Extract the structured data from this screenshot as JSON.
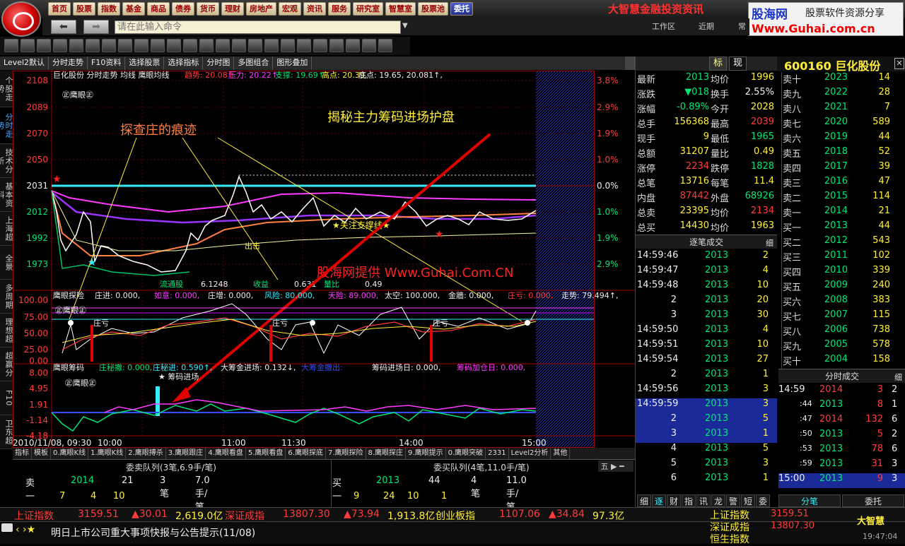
{
  "menu": [
    "首页",
    "股票",
    "指数",
    "基金",
    "商品",
    "债券",
    "货币",
    "理财",
    "房地产",
    "宏观",
    "资讯",
    "服务",
    "研究室",
    "智慧室",
    "股票池",
    "委托"
  ],
  "menu_active": 15,
  "brand": "大智慧金融投资资讯",
  "watermark_top": {
    "site": "股海网",
    "tag": "股票软件资源分享",
    "url": "Www.Guhai.com.cn"
  },
  "command_placeholder": "请在此输入命令",
  "right_links": [
    "工作区",
    "近期",
    "常"
  ],
  "tabbar": [
    "Level2默认",
    "分时走势",
    "F10资料",
    "选择股票",
    "选择指标",
    "分时图",
    "多图组合",
    "图形叠加"
  ],
  "vtabs": [
    "个股走势",
    "分时走势",
    "技术分析",
    "基本资料",
    "上海超",
    "全景",
    "多周期",
    "理想超",
    "超赢分",
    "F10",
    "卫东超"
  ],
  "vtab_selected": 1,
  "chart": {
    "title": "巨化股份 分时走势  均线  鹰眼均线",
    "price_line_labels": [
      {
        "text": "趋势: 20.08↑",
        "color": "#ff3b3b"
      },
      {
        "text": "压力: 20.22↑",
        "color": "#ff3bff"
      },
      {
        "text": "支撑: 19.69↑",
        "color": "#00e676"
      },
      {
        "text": "高点: 20.39,",
        "color": "#ffef3a"
      },
      {
        "text": "底点: 19.65,  20.081↑,",
        "color": "#eee"
      }
    ],
    "y_labels_left": [
      "2108",
      "2089",
      "2070",
      "2050",
      "2031",
      "2012",
      "1992",
      "1973"
    ],
    "y_labels_right": [
      "3.8%",
      "2.9%",
      "1.9%",
      "1.0%",
      "0.0%",
      "1.0%",
      "1.9%",
      "2.9%"
    ],
    "eye_tag": "㊣鹰眼㊣",
    "annotation_1": "探查庄的痕迹",
    "annotation_2": "揭秘主力筹码进场护盘",
    "support_text": "★关注支撑线★",
    "exit_text": "出击",
    "watermark": "股海网提供 Www.Guhai.Com.CN",
    "bottom_stats": [
      {
        "k": "流通股",
        "v": "6.1248"
      },
      {
        "k": "收益",
        "v": "0.631"
      },
      {
        "k": "量比",
        "v": "0.49"
      }
    ],
    "panel2_title": "鹰眼探险",
    "panel2_items": [
      {
        "text": "庄进: 0.000,",
        "color": "#eee"
      },
      {
        "text": "如意: 0.000,",
        "color": "#ff3bff"
      },
      {
        "text": "庄增: 0.000,",
        "color": "#eee"
      },
      {
        "text": "风险: 80.000,",
        "color": "#3ef"
      },
      {
        "text": "天险: 89.000,",
        "color": "#ff3bff"
      },
      {
        "text": "太空: 100.000,",
        "color": "#eee"
      },
      {
        "text": "金牆: 0.000,",
        "color": "#eee"
      },
      {
        "text": "庄亏: 0.000,",
        "color": "#ff3b3b"
      },
      {
        "text": "走势: 79.494↑,",
        "color": "#eee"
      }
    ],
    "panel2_y": [
      "100.00",
      "75.00",
      "50.00",
      "25.00",
      "0.00"
    ],
    "panel2_marks": [
      "庄亏",
      "庄亏",
      "庄亏"
    ],
    "panel3_title": "鹰眼筹码",
    "panel3_items": [
      {
        "text": "庄秘撤: 0.000,",
        "color": "#00e676"
      },
      {
        "text": "庄秘进: 0.590↑,",
        "color": "#3ef"
      },
      {
        "text": "大筹金进场: 0.132↓,",
        "color": "#eee"
      },
      {
        "text": "大筹金撤出: ",
        "color": "#3050ff"
      },
      {
        "text": "筹码进场日: 0.000,",
        "color": "#eee"
      },
      {
        "text": "筹码加仓日: 0.000,",
        "color": "#ff3bff"
      }
    ],
    "panel3_y": [
      "8.00",
      "4.95",
      "1.91",
      "-1.14",
      "-4.18"
    ],
    "panel3_mark": "★ 筹码进场",
    "x_labels": [
      "2010/11/08, 09:30",
      "10:00",
      "11:00",
      "11:30",
      "14:00",
      "15:00"
    ]
  },
  "botbar1": [
    "指标",
    "模板",
    "0.鹰眼K线",
    "1.鹰眼K线",
    "2.鹰眼搏杀",
    "3.鹰眼跟庄",
    "4.鹰眼看盘",
    "5.鹰眼看盘",
    "6.鹰眼探底",
    "7.鹰眼探险",
    "8.鹰眼探庄",
    "9.鹰眼提示",
    "0.鹰眼突破",
    "2331",
    "Level2分析",
    "其他"
  ],
  "queue": {
    "sell_title": "委卖队列(3笔,6.9手/笔)",
    "buy_title": "委买队列(4笔,11.0手/笔)",
    "sell_row": [
      "卖一",
      "2014",
      "21",
      "3笔",
      "7.0手/笔"
    ],
    "sell_detail": [
      "7",
      "4",
      "10"
    ],
    "buy_row": [
      "买一",
      "2013",
      "44",
      "4笔",
      "11.0手/笔"
    ],
    "buy_detail": [
      "9",
      "24",
      "10",
      "1"
    ]
  },
  "quote": {
    "tabs": [
      "标",
      "现"
    ],
    "stock": "600160 巨化股份",
    "stats": [
      [
        "最新",
        "2013",
        "均价",
        "1996"
      ],
      [
        "涨跌",
        "▼018",
        "换手",
        "2.55%"
      ],
      [
        "涨幅",
        "-0.89%",
        "今开",
        "2028"
      ],
      [
        "总手",
        "156368",
        "最高",
        "2039"
      ],
      [
        "现手",
        "9",
        "最低",
        "1965"
      ],
      [
        "总额",
        "31207",
        "量比",
        "0.49"
      ],
      [
        "涨停",
        "2234",
        "跌停",
        "1828"
      ],
      [
        "总笔",
        "13716",
        "每笔",
        "11.4"
      ],
      [
        "内盘",
        "87442",
        "外盘",
        "68926"
      ],
      [
        "总卖",
        "23395",
        "均价",
        "2134"
      ],
      [
        "总买",
        "14430",
        "均价",
        "1963"
      ]
    ],
    "asks": [
      [
        "卖十",
        "2023",
        "14"
      ],
      [
        "卖九",
        "2022",
        "28"
      ],
      [
        "卖八",
        "2021",
        "7"
      ],
      [
        "卖七",
        "2020",
        "589"
      ],
      [
        "卖六",
        "2019",
        "44"
      ],
      [
        "卖五",
        "2018",
        "52"
      ],
      [
        "卖四",
        "2017",
        "39"
      ],
      [
        "卖三",
        "2016",
        "47"
      ],
      [
        "卖二",
        "2015",
        "114"
      ],
      [
        "卖一",
        "2014",
        "21"
      ]
    ],
    "bids": [
      [
        "买一",
        "2013",
        "44"
      ],
      [
        "买二",
        "2012",
        "543"
      ],
      [
        "买三",
        "2011",
        "102"
      ],
      [
        "买四",
        "2010",
        "339"
      ],
      [
        "买五",
        "2009",
        "240"
      ],
      [
        "买六",
        "2008",
        "383"
      ],
      [
        "买七",
        "2007",
        "115"
      ],
      [
        "买八",
        "2006",
        "738"
      ],
      [
        "买九",
        "2005",
        "578"
      ],
      [
        "买十",
        "2004",
        "158"
      ]
    ],
    "ticks_title": "逐笔成交",
    "ticks_tab": "细",
    "ticks": [
      [
        "14:59:46",
        "2013",
        "2"
      ],
      [
        "14:59:47",
        "2013",
        "4"
      ],
      [
        "14:59:48",
        "2013",
        "10"
      ],
      [
        "2",
        "2013",
        "20"
      ],
      [
        "3",
        "2013",
        "30"
      ],
      [
        "14:59:50",
        "2013",
        "4"
      ],
      [
        "14:59:51",
        "2013",
        "10"
      ],
      [
        "14:59:54",
        "2013",
        "27"
      ],
      [
        "2",
        "2013",
        "1"
      ],
      [
        "14:59:56",
        "2013",
        "3"
      ],
      [
        "14:59:59",
        "2013",
        "3"
      ],
      [
        "2",
        "2013",
        "5"
      ],
      [
        "3",
        "2013",
        "1"
      ],
      [
        "4",
        "2013",
        "5"
      ],
      [
        "5",
        "2013",
        "3"
      ],
      [
        "6",
        "2013",
        "1"
      ]
    ],
    "minute_title": "分时成交",
    "minute_tab": "细",
    "minute": [
      [
        "14:59",
        "2014",
        "3",
        "2"
      ],
      [
        ":44",
        "2013",
        "8",
        "1"
      ],
      [
        ":47",
        "2014",
        "132",
        "6"
      ],
      [
        ":50",
        "2013",
        "5",
        "2"
      ],
      [
        ":53",
        "2013",
        "78",
        "6"
      ],
      [
        ":59",
        "2013",
        "31",
        "3"
      ],
      [
        "15:00",
        "2013",
        "9",
        "3"
      ]
    ],
    "bottom_tabs_left": [
      "细",
      "逐",
      "财",
      "指",
      "讯",
      "龙",
      "警",
      "短",
      "委"
    ],
    "bottom_tabs_right": [
      "分笔",
      "委托"
    ]
  },
  "status": {
    "sh_name": "上证指数",
    "sh_val": "3159.51",
    "sh_chg": "▲30.01",
    "sh_amt": "2,619.0亿",
    "sz_name": "深证成指",
    "sz_val": "13807.30",
    "sz_chg": "▲73.94",
    "sz_amt": "1,913.8亿",
    "cy_name": "创业板指",
    "cy_val": "1107.06",
    "cy_chg": "▲34.84",
    "cy_amt": "97.3亿"
  },
  "news": {
    "text": "明日上市公司重大事项快报与公告提示(11/08)",
    "idx": [
      "上证指数",
      "深证成指",
      "恒生指数"
    ],
    "vals": [
      "3159.51",
      "13807.30",
      ""
    ],
    "chgs": [
      "▲30.01",
      "▲73.94",
      ""
    ],
    "logo": "大智慧",
    "time": "19:47:04"
  }
}
